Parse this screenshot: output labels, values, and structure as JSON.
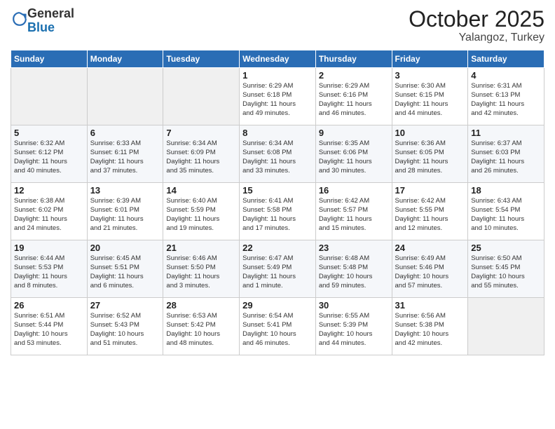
{
  "logo": {
    "general": "General",
    "blue": "Blue"
  },
  "header": {
    "month": "October 2025",
    "location": "Yalangoz, Turkey"
  },
  "weekdays": [
    "Sunday",
    "Monday",
    "Tuesday",
    "Wednesday",
    "Thursday",
    "Friday",
    "Saturday"
  ],
  "weeks": [
    [
      {
        "day": "",
        "info": ""
      },
      {
        "day": "",
        "info": ""
      },
      {
        "day": "",
        "info": ""
      },
      {
        "day": "1",
        "info": "Sunrise: 6:29 AM\nSunset: 6:18 PM\nDaylight: 11 hours\nand 49 minutes."
      },
      {
        "day": "2",
        "info": "Sunrise: 6:29 AM\nSunset: 6:16 PM\nDaylight: 11 hours\nand 46 minutes."
      },
      {
        "day": "3",
        "info": "Sunrise: 6:30 AM\nSunset: 6:15 PM\nDaylight: 11 hours\nand 44 minutes."
      },
      {
        "day": "4",
        "info": "Sunrise: 6:31 AM\nSunset: 6:13 PM\nDaylight: 11 hours\nand 42 minutes."
      }
    ],
    [
      {
        "day": "5",
        "info": "Sunrise: 6:32 AM\nSunset: 6:12 PM\nDaylight: 11 hours\nand 40 minutes."
      },
      {
        "day": "6",
        "info": "Sunrise: 6:33 AM\nSunset: 6:11 PM\nDaylight: 11 hours\nand 37 minutes."
      },
      {
        "day": "7",
        "info": "Sunrise: 6:34 AM\nSunset: 6:09 PM\nDaylight: 11 hours\nand 35 minutes."
      },
      {
        "day": "8",
        "info": "Sunrise: 6:34 AM\nSunset: 6:08 PM\nDaylight: 11 hours\nand 33 minutes."
      },
      {
        "day": "9",
        "info": "Sunrise: 6:35 AM\nSunset: 6:06 PM\nDaylight: 11 hours\nand 30 minutes."
      },
      {
        "day": "10",
        "info": "Sunrise: 6:36 AM\nSunset: 6:05 PM\nDaylight: 11 hours\nand 28 minutes."
      },
      {
        "day": "11",
        "info": "Sunrise: 6:37 AM\nSunset: 6:03 PM\nDaylight: 11 hours\nand 26 minutes."
      }
    ],
    [
      {
        "day": "12",
        "info": "Sunrise: 6:38 AM\nSunset: 6:02 PM\nDaylight: 11 hours\nand 24 minutes."
      },
      {
        "day": "13",
        "info": "Sunrise: 6:39 AM\nSunset: 6:01 PM\nDaylight: 11 hours\nand 21 minutes."
      },
      {
        "day": "14",
        "info": "Sunrise: 6:40 AM\nSunset: 5:59 PM\nDaylight: 11 hours\nand 19 minutes."
      },
      {
        "day": "15",
        "info": "Sunrise: 6:41 AM\nSunset: 5:58 PM\nDaylight: 11 hours\nand 17 minutes."
      },
      {
        "day": "16",
        "info": "Sunrise: 6:42 AM\nSunset: 5:57 PM\nDaylight: 11 hours\nand 15 minutes."
      },
      {
        "day": "17",
        "info": "Sunrise: 6:42 AM\nSunset: 5:55 PM\nDaylight: 11 hours\nand 12 minutes."
      },
      {
        "day": "18",
        "info": "Sunrise: 6:43 AM\nSunset: 5:54 PM\nDaylight: 11 hours\nand 10 minutes."
      }
    ],
    [
      {
        "day": "19",
        "info": "Sunrise: 6:44 AM\nSunset: 5:53 PM\nDaylight: 11 hours\nand 8 minutes."
      },
      {
        "day": "20",
        "info": "Sunrise: 6:45 AM\nSunset: 5:51 PM\nDaylight: 11 hours\nand 6 minutes."
      },
      {
        "day": "21",
        "info": "Sunrise: 6:46 AM\nSunset: 5:50 PM\nDaylight: 11 hours\nand 3 minutes."
      },
      {
        "day": "22",
        "info": "Sunrise: 6:47 AM\nSunset: 5:49 PM\nDaylight: 11 hours\nand 1 minute."
      },
      {
        "day": "23",
        "info": "Sunrise: 6:48 AM\nSunset: 5:48 PM\nDaylight: 10 hours\nand 59 minutes."
      },
      {
        "day": "24",
        "info": "Sunrise: 6:49 AM\nSunset: 5:46 PM\nDaylight: 10 hours\nand 57 minutes."
      },
      {
        "day": "25",
        "info": "Sunrise: 6:50 AM\nSunset: 5:45 PM\nDaylight: 10 hours\nand 55 minutes."
      }
    ],
    [
      {
        "day": "26",
        "info": "Sunrise: 6:51 AM\nSunset: 5:44 PM\nDaylight: 10 hours\nand 53 minutes."
      },
      {
        "day": "27",
        "info": "Sunrise: 6:52 AM\nSunset: 5:43 PM\nDaylight: 10 hours\nand 51 minutes."
      },
      {
        "day": "28",
        "info": "Sunrise: 6:53 AM\nSunset: 5:42 PM\nDaylight: 10 hours\nand 48 minutes."
      },
      {
        "day": "29",
        "info": "Sunrise: 6:54 AM\nSunset: 5:41 PM\nDaylight: 10 hours\nand 46 minutes."
      },
      {
        "day": "30",
        "info": "Sunrise: 6:55 AM\nSunset: 5:39 PM\nDaylight: 10 hours\nand 44 minutes."
      },
      {
        "day": "31",
        "info": "Sunrise: 6:56 AM\nSunset: 5:38 PM\nDaylight: 10 hours\nand 42 minutes."
      },
      {
        "day": "",
        "info": ""
      }
    ]
  ]
}
